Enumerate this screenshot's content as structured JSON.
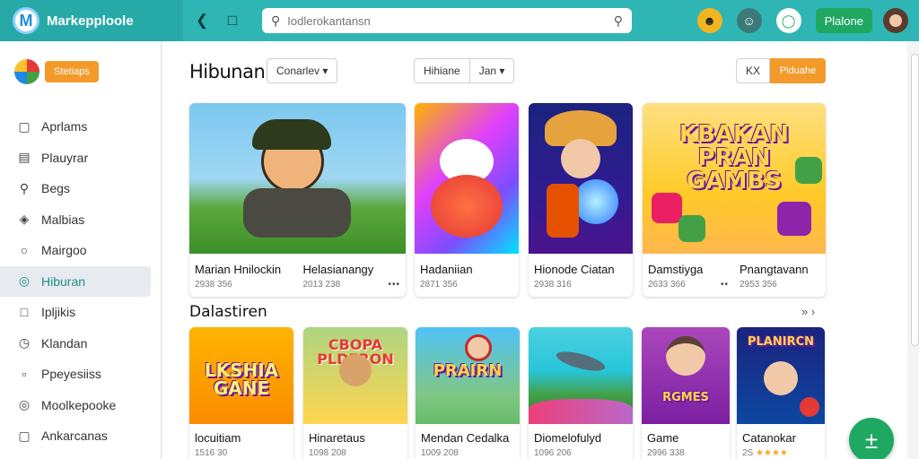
{
  "app": {
    "name": "Markepploole",
    "logo_letter": "M"
  },
  "topbar": {
    "back_icon": "chevron-left-icon",
    "window_icon": "window-icon",
    "search_placeholder": "Iodlerokantansn",
    "premium_label": "Plalone",
    "colors": {
      "bar": "#2fb6b4",
      "premium": "#1fa862"
    }
  },
  "sidebar": {
    "badge": "Stetiaps",
    "items": [
      {
        "label": "Aprlams",
        "icon": "square-icon"
      },
      {
        "label": "Plauyrar",
        "icon": "list-icon"
      },
      {
        "label": "Begs",
        "icon": "search-icon"
      },
      {
        "label": "Malbias",
        "icon": "tag-icon"
      },
      {
        "label": "Mairgoo",
        "icon": "user-icon"
      },
      {
        "label": "Hiburan",
        "icon": "circle-icon",
        "active": true
      },
      {
        "label": "Ipljikis",
        "icon": "box-icon"
      },
      {
        "label": "Klandan",
        "icon": "clock-icon"
      },
      {
        "label": "Ppeyesiiss",
        "icon": "page-icon"
      },
      {
        "label": "Moolkepooke",
        "icon": "circle-icon"
      },
      {
        "label": "Ankarcanas",
        "icon": "square-icon"
      }
    ]
  },
  "main": {
    "title": "Hibunan",
    "category_dropdown": "Conarlev",
    "filter_left": "Hihiane",
    "filter_right": "Jan",
    "btn_x": "KX",
    "btn_orange": "Piduahe",
    "section2_title": "Dalastiren",
    "section2_more": "»  ›"
  },
  "row1": [
    {
      "title": "Marian Hnilockin",
      "meta": "2938 356",
      "thumb_text": ""
    },
    {
      "title": "Helasianangy",
      "meta": "2013 238",
      "thumb_text": "",
      "dots": "•••"
    },
    {
      "title": "Hadaniian",
      "meta": "2871 356",
      "thumb_text": ""
    },
    {
      "title": "Hionode Ciatan",
      "meta": "2938 316",
      "thumb_text": ""
    },
    {
      "title": "Damstiyga",
      "meta": "2633 366",
      "thumb_text": "KBAKAN PRAN GAMBS",
      "dots": "••"
    },
    {
      "title": "Pnangtavann",
      "meta": "2953 356",
      "thumb_text": ""
    }
  ],
  "row2": [
    {
      "title": "locuitiam",
      "meta": "1516 30",
      "thumb_text": "LKSHIA GANE"
    },
    {
      "title": "Hinaretaus",
      "meta": "1098 208",
      "thumb_text": "CBOPA PLDERON"
    },
    {
      "title": "Mendan Cedalka",
      "meta": "1009 208",
      "thumb_text": "PRAIRN"
    },
    {
      "title": "Diomelofulyd",
      "meta": "1096 206",
      "thumb_text": ""
    },
    {
      "title": "Game",
      "meta": "2996 338",
      "thumb_text": "RGMES"
    },
    {
      "title": "Catanokar",
      "meta": "2S",
      "thumb_text": "PLANIRCN",
      "stars": "★★★★"
    }
  ]
}
